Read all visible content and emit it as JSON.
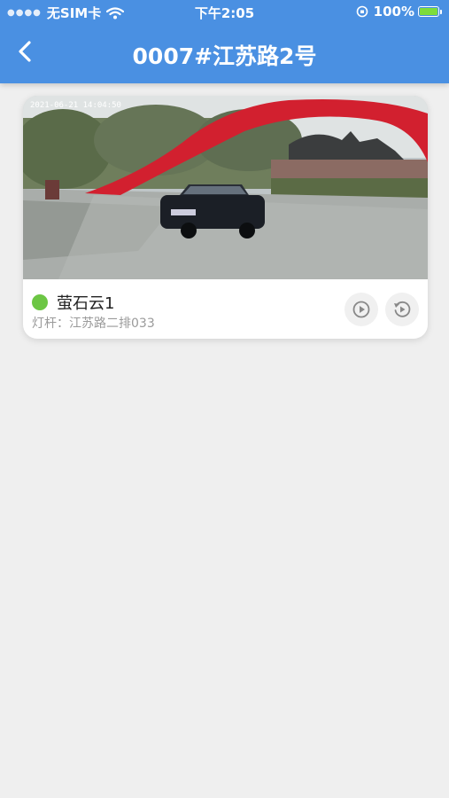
{
  "status_bar": {
    "carrier": "无SIM卡",
    "time": "下午2:05",
    "battery": "100%"
  },
  "nav": {
    "title": "0007#江苏路2号"
  },
  "camera": {
    "name": "萤石云1",
    "pole": "灯杆：江苏路二排033",
    "timestamp": "2021-06-21 14:04:50",
    "status_color": "#6cc644"
  }
}
